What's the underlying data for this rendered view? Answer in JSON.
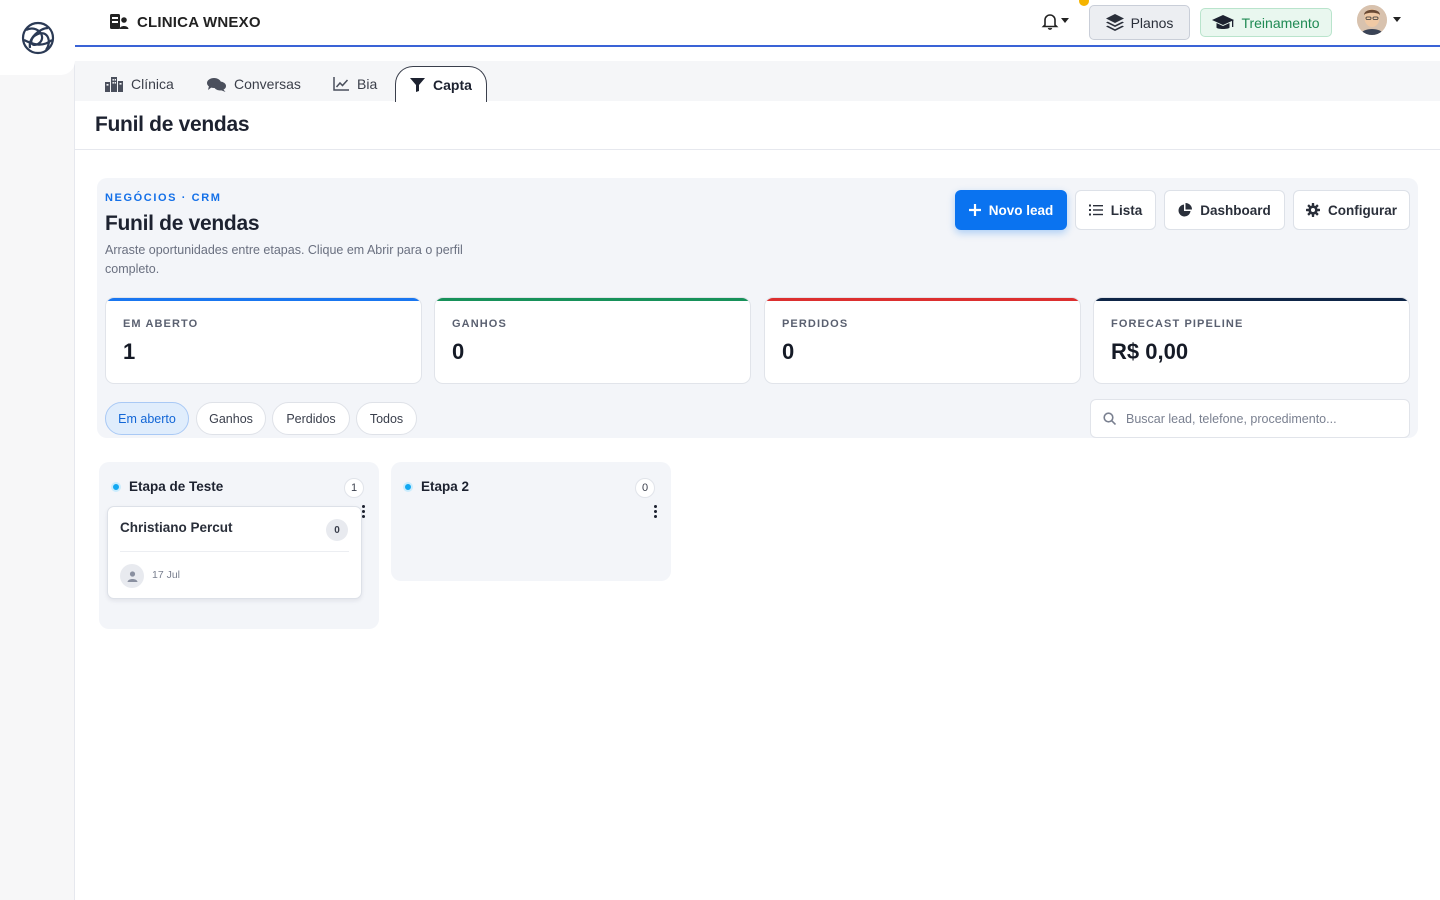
{
  "app": {
    "clinic_name": "CLINICA WNEXO"
  },
  "header": {
    "planos_label": "Planos",
    "treinamento_label": "Treinamento"
  },
  "nav": {
    "tabs": [
      {
        "label": "Clínica",
        "icon": "building-icon"
      },
      {
        "label": "Conversas",
        "icon": "chat-icon"
      },
      {
        "label": "Bia",
        "icon": "line-chart-icon"
      },
      {
        "label": "Capta",
        "icon": "funnel-icon",
        "active": true
      }
    ]
  },
  "page": {
    "title": "Funil de vendas"
  },
  "panel": {
    "eyebrow": "NEGÓCIOS · CRM",
    "title": "Funil de vendas",
    "description": "Arraste oportunidades entre etapas. Clique em Abrir para o perfil completo.",
    "actions": {
      "new_lead": "Novo lead",
      "list": "Lista",
      "dashboard": "Dashboard",
      "configure": "Configurar"
    },
    "kpis": [
      {
        "label": "EM ABERTO",
        "value": "1",
        "color": "#1976f0"
      },
      {
        "label": "GANHOS",
        "value": "0",
        "color": "#17915a"
      },
      {
        "label": "PERDIDOS",
        "value": "0",
        "color": "#dc2f2f"
      },
      {
        "label": "FORECAST PIPELINE",
        "value": "R$ 0,00",
        "color": "#0e2547"
      }
    ],
    "filters": [
      "Em aberto",
      "Ganhos",
      "Perdidos",
      "Todos"
    ],
    "active_filter": "Em aberto",
    "search_placeholder": "Buscar lead, telefone, procedimento..."
  },
  "kanban": {
    "columns": [
      {
        "title": "Etapa de Teste",
        "count": "1",
        "cards": [
          {
            "name": "Christiano Percut",
            "badge": "0",
            "date": "17 Jul"
          }
        ]
      },
      {
        "title": "Etapa 2",
        "count": "0",
        "cards": []
      }
    ]
  },
  "colors": {
    "primary": "#0a73f0",
    "accent_line": "#3a63d6",
    "notification_dot": "#f5b400"
  }
}
